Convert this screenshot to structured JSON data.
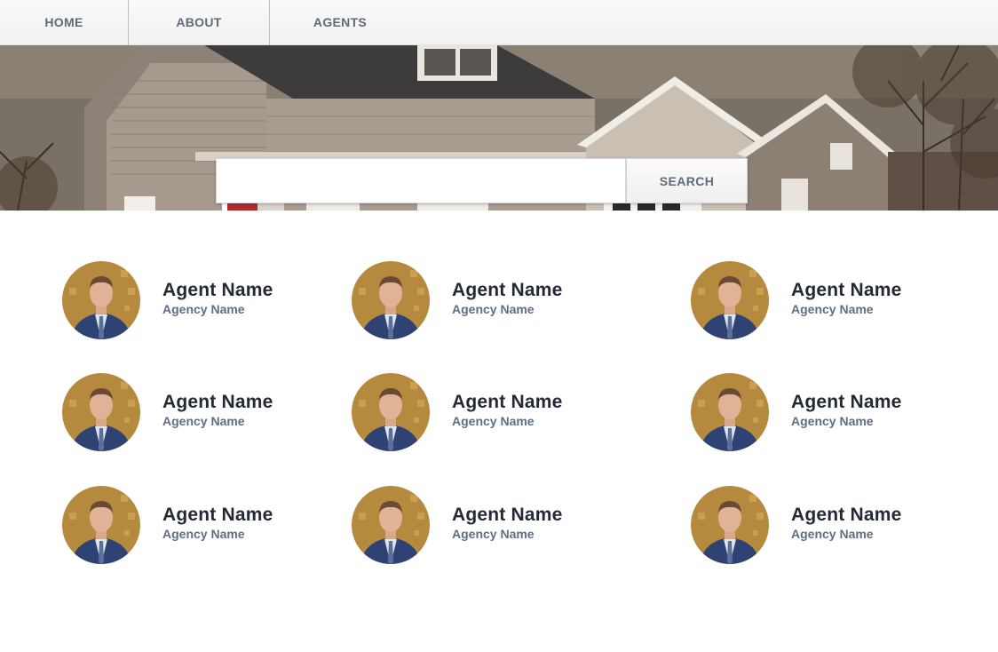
{
  "nav": {
    "items": [
      {
        "label": "HOME"
      },
      {
        "label": "ABOUT"
      },
      {
        "label": "AGENTS"
      }
    ]
  },
  "search": {
    "value": "",
    "placeholder": "",
    "button_label": "SEARCH"
  },
  "agents": [
    {
      "name": "Agent Name",
      "agency": "Agency Name"
    },
    {
      "name": "Agent Name",
      "agency": "Agency Name"
    },
    {
      "name": "Agent Name",
      "agency": "Agency Name"
    },
    {
      "name": "Agent Name",
      "agency": "Agency Name"
    },
    {
      "name": "Agent Name",
      "agency": "Agency Name"
    },
    {
      "name": "Agent Name",
      "agency": "Agency Name"
    },
    {
      "name": "Agent Name",
      "agency": "Agency Name"
    },
    {
      "name": "Agent Name",
      "agency": "Agency Name"
    },
    {
      "name": "Agent Name",
      "agency": "Agency Name"
    }
  ],
  "colors": {
    "nav_text": "#5d6b7c",
    "agent_name": "#232a35",
    "agency_name": "#5e6e84"
  }
}
